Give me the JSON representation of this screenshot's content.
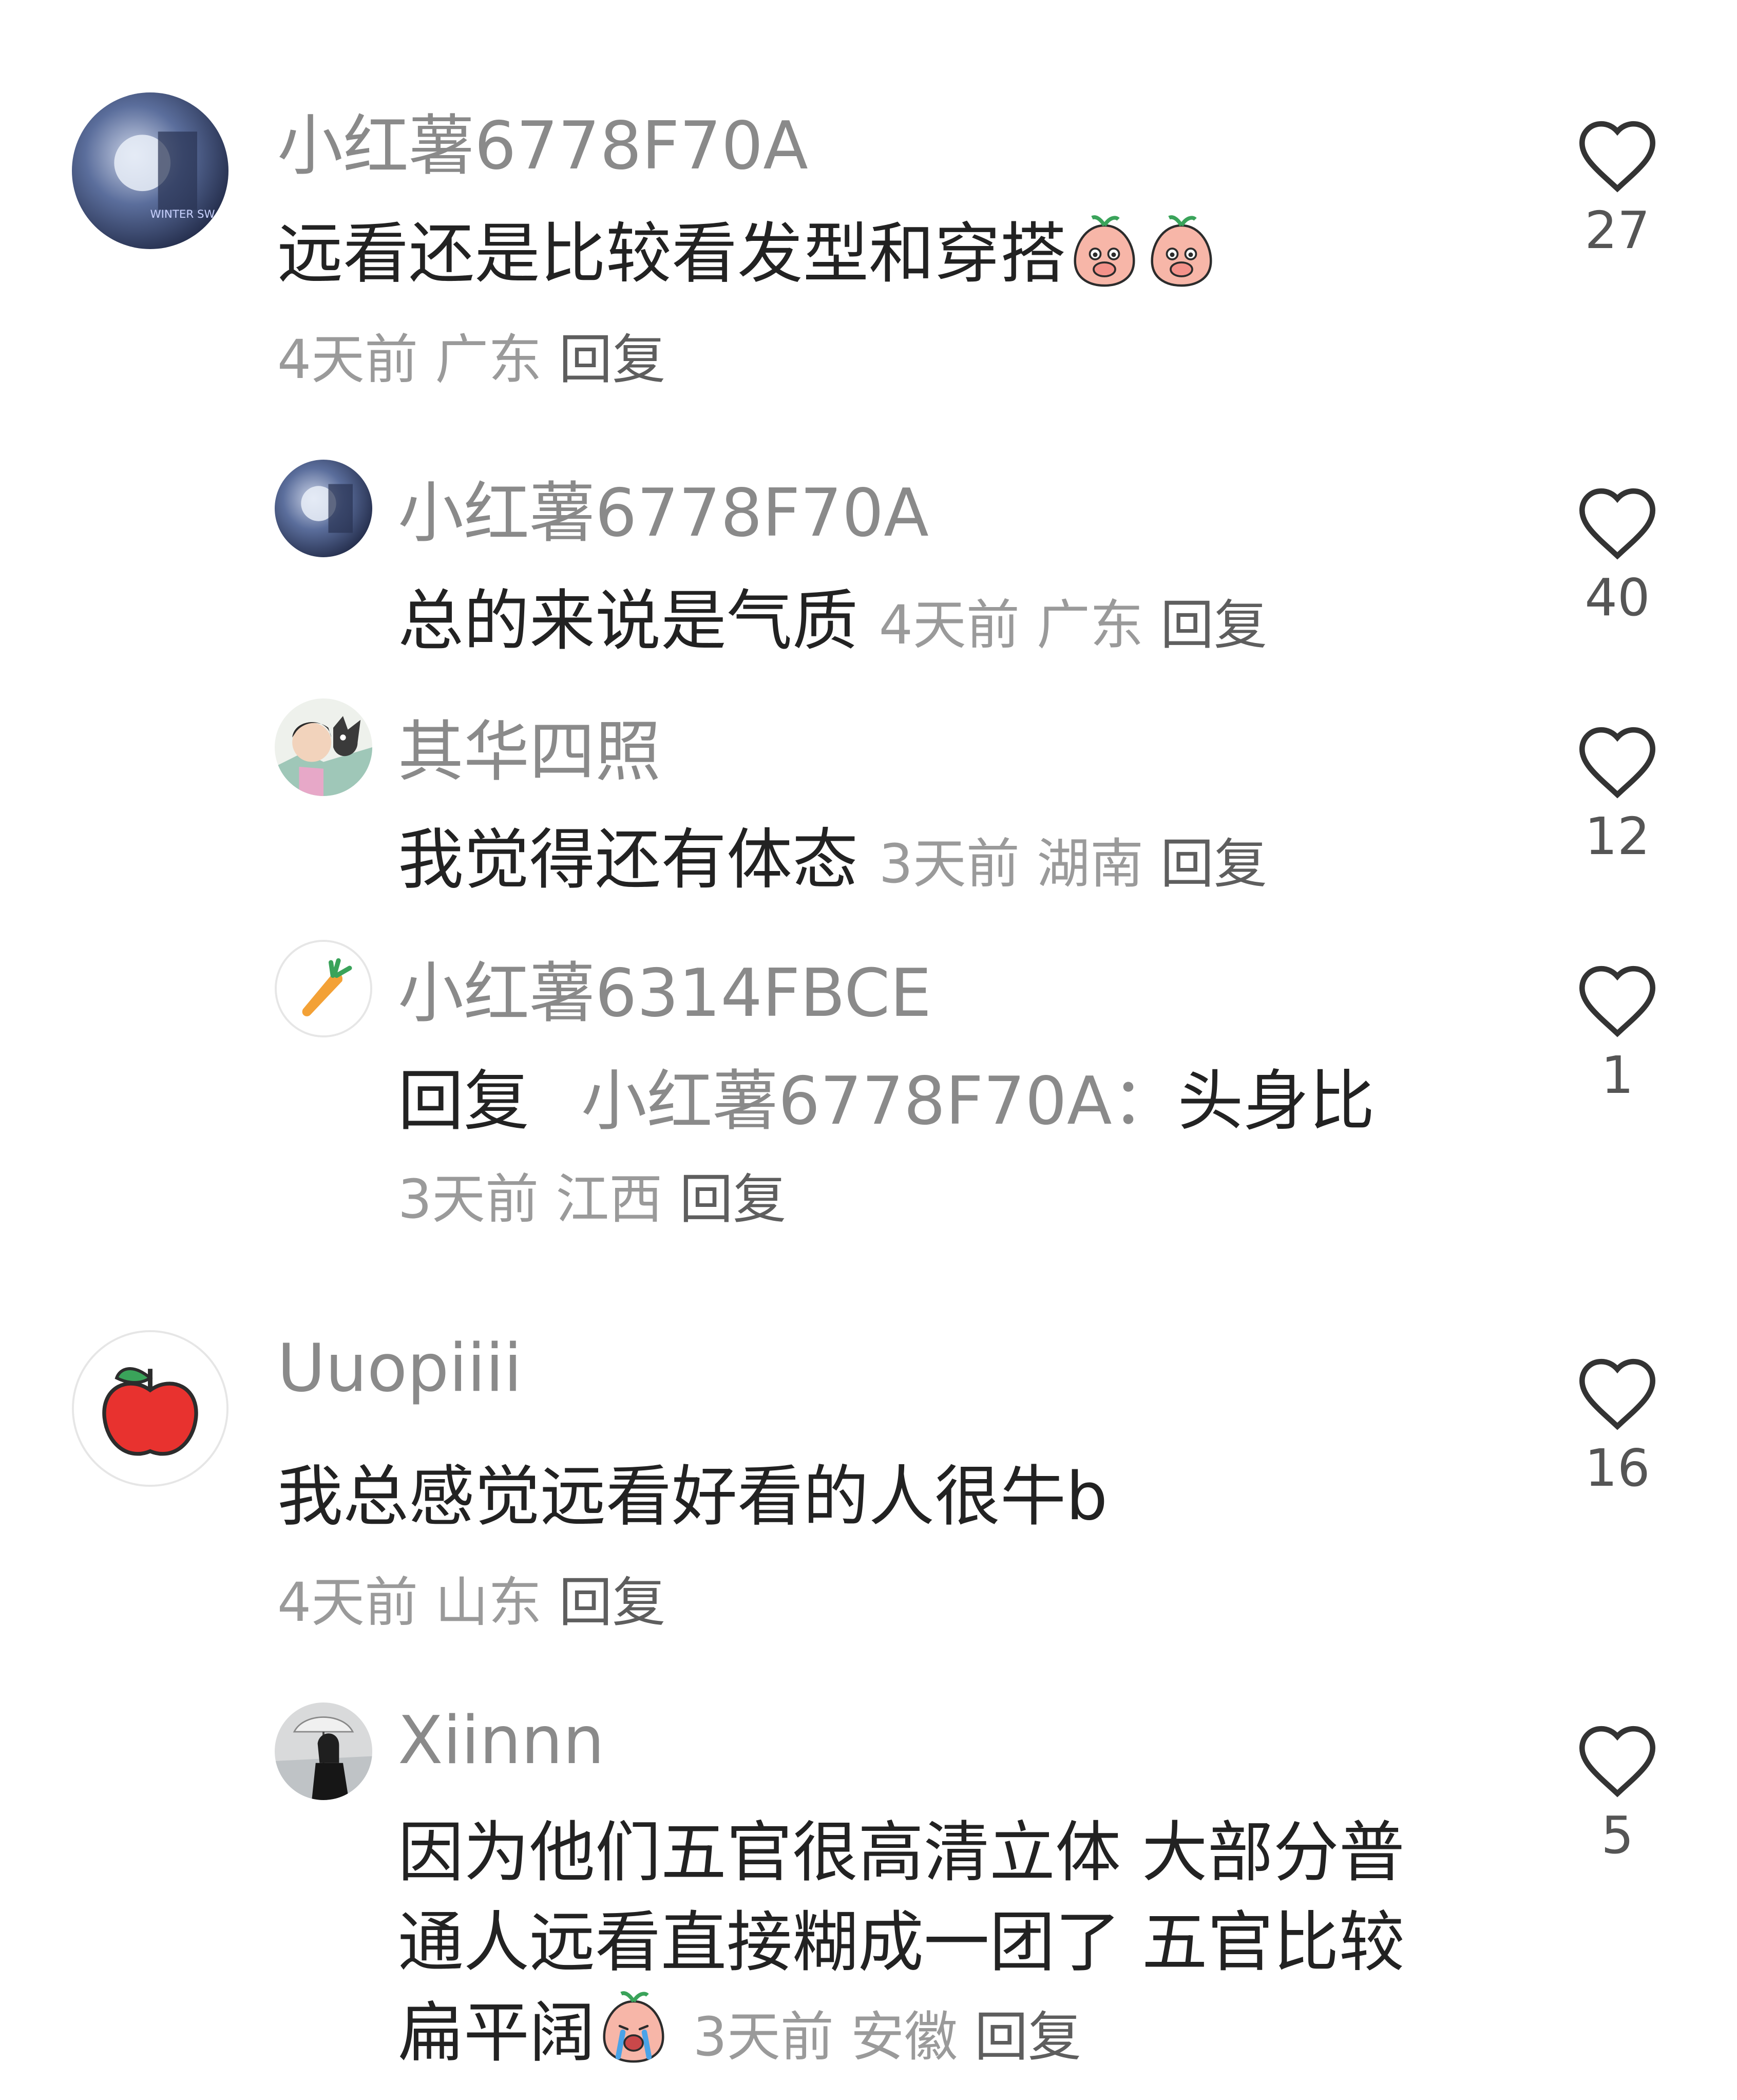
{
  "comments": [
    {
      "username": "小红薯6778F70A",
      "text": "远看还是比较看发型和穿搭",
      "time": "4天前",
      "location": "广东",
      "reply_label": "回复",
      "likes": "27",
      "avatar_icon": "photo-avatar-winter-icon",
      "emoji_icon": "peach-covering-mouth-emoji"
    },
    {
      "username": "小红薯6778F70A",
      "text": "总的来说是气质",
      "time": "4天前",
      "location": "广东",
      "reply_label": "回复",
      "likes": "40",
      "avatar_icon": "photo-avatar-winter-icon"
    },
    {
      "username": "其华四照",
      "text": "我觉得还有体态",
      "time": "3天前",
      "location": "湖南",
      "reply_label": "回复",
      "likes": "12",
      "avatar_icon": "photo-avatar-girl-with-cat-icon"
    },
    {
      "username": "小红薯6314FBCE",
      "reply_prefix": "回复",
      "mention": "小红薯6778F70A：",
      "text": "头身比",
      "time": "3天前",
      "location": "江西",
      "reply_label": "回复",
      "likes": "1",
      "avatar_icon": "carrot-avatar-icon"
    },
    {
      "username": "Uuopiiii",
      "text": "我总感觉远看好看的人很牛b",
      "time": "4天前",
      "location": "山东",
      "reply_label": "回复",
      "likes": "16",
      "avatar_icon": "apple-avatar-icon"
    },
    {
      "username": "Xiinnn",
      "text": "因为他们五官很高清立体 大部分普通人远看直接糊成一团了 五官比较扁平阔",
      "time": "3天前",
      "location": "安徽",
      "reply_label": "回复",
      "likes": "5",
      "avatar_icon": "photo-avatar-girl-umbrella-icon",
      "emoji_icon": "peach-crying-emoji"
    }
  ],
  "colors": {
    "username": "#8a8a8a",
    "text": "#222222",
    "meta": "#9a9a9a",
    "like_icon_stroke": "#333333"
  }
}
